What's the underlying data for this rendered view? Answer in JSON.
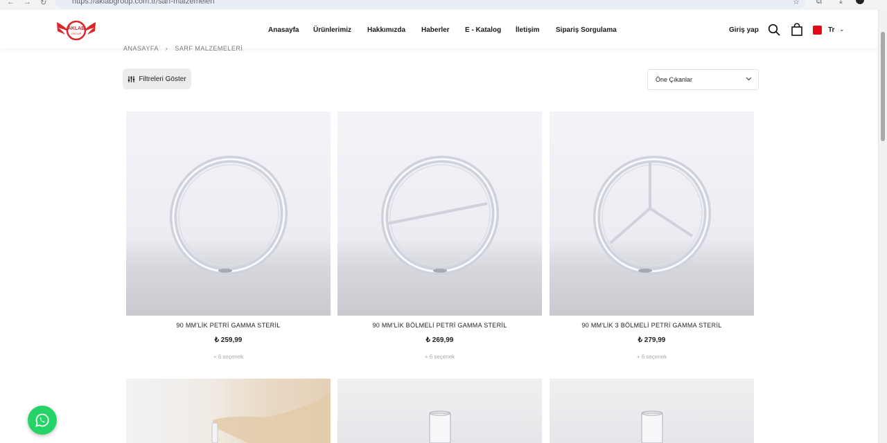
{
  "browser": {
    "url": "https://aklabgroup.com.tr/sarf-malzemeleri"
  },
  "header": {
    "nav": [
      {
        "label": "Anasayfa"
      },
      {
        "label": "Ürünlerimiz"
      },
      {
        "label": "Hakkımızda"
      },
      {
        "label": "Haberler"
      },
      {
        "label": "E - Katalog"
      },
      {
        "label": "İletişim"
      },
      {
        "label": "Sipariş Sorgulama"
      }
    ],
    "login_label": "Giriş yap",
    "language": "Tr",
    "logo_text": "AKLAB GROUP"
  },
  "breadcrumb": {
    "home": "ANASAYFA",
    "current": "SARF MALZEMELERİ"
  },
  "toolbar": {
    "filter_label": "Filtreleri Göster",
    "sort_selected": "Öne Çıkanlar"
  },
  "products": [
    {
      "title": "90 MM'LİK PETRİ GAMMA STERİL",
      "price": "₺ 259,99",
      "options": "+ 6 seçenek"
    },
    {
      "title": "90 MM'LİK BÖLMELİ PETRİ GAMMA STERİL",
      "price": "₺ 269,99",
      "options": "+ 6 seçenek"
    },
    {
      "title": "90 MM'LİK 3 BÖLMELİ PETRİ GAMMA STERİL",
      "price": "₺ 279,99",
      "options": "+ 6 seçenek"
    }
  ],
  "colors": {
    "brand_red": "#d9262c",
    "whatsapp_green": "#25d366"
  }
}
